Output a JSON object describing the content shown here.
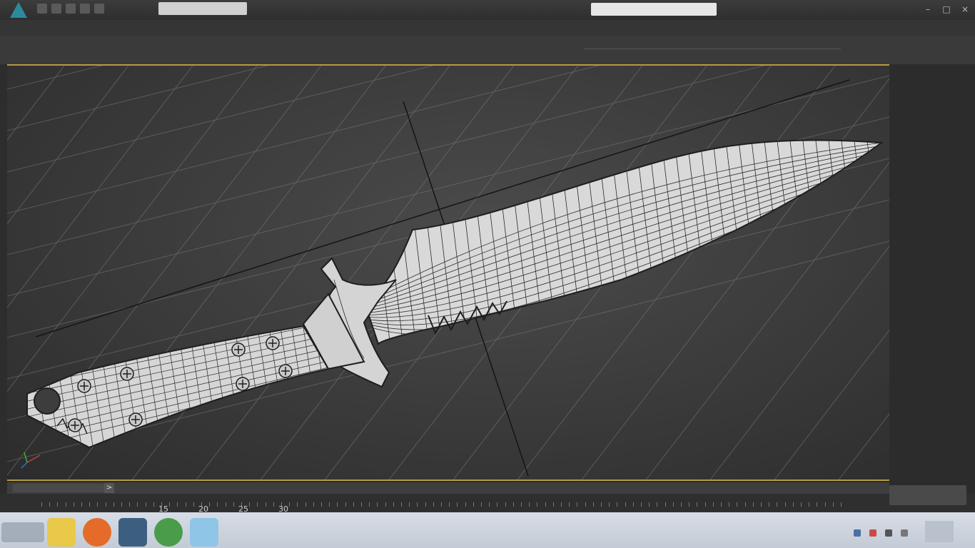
{
  "app": {
    "title_text": "",
    "help_search_placeholder": "",
    "window_controls": {
      "minimize": "–",
      "maximize": "□",
      "close": "×"
    }
  },
  "menubar": {
    "items": [
      "",
      "",
      "",
      "",
      "",
      "",
      "",
      "",
      "",
      "",
      "",
      "",
      "",
      "",
      "",
      ""
    ]
  },
  "ribbon": {
    "tabs": [
      "",
      "",
      "",
      "",
      "",
      ""
    ]
  },
  "viewport": {
    "label": "",
    "background_color": "#3d3d3d",
    "border_color": "#b79a3e",
    "grid_color": "#7a7a7a",
    "mesh_fill": "#d9d9d9",
    "mesh_wire": "#2a2a2a",
    "viewcube_icon": "viewcube-icon",
    "axis_icon": "axis-tripod-icon"
  },
  "timeline": {
    "frame_field": "",
    "next_label": ">",
    "tick_labels": [
      "15",
      "20",
      "25",
      "30"
    ]
  },
  "taskbar": {
    "start_label": "",
    "apps": [
      {
        "icon": "explorer-icon",
        "color": "#e9c84a"
      },
      {
        "icon": "firefox-icon",
        "color": "#e56b2a"
      },
      {
        "icon": "3dsmax-icon",
        "color": "#3d5f7f"
      },
      {
        "icon": "chrome-icon",
        "color": "#4a9b4a"
      },
      {
        "icon": "document-icon",
        "color": "#8fc5e6"
      }
    ],
    "clock": ""
  }
}
